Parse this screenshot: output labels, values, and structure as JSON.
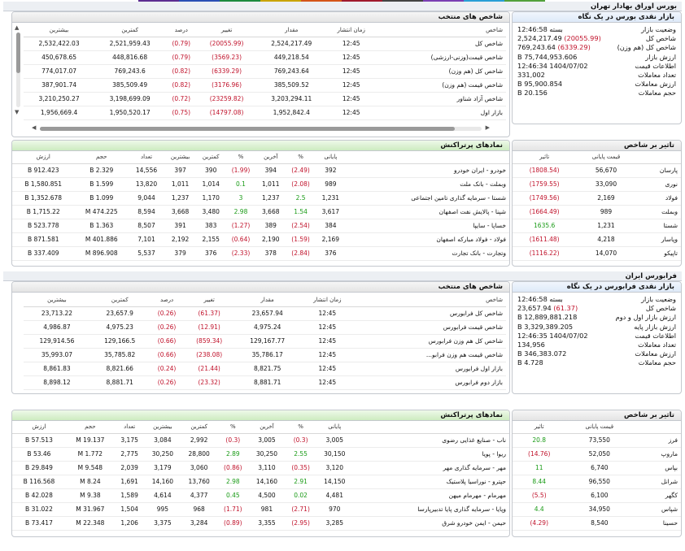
{
  "colors": {
    "neg": "#c0112a",
    "pos": "#1a9b17",
    "header_blue": "#dde9f8",
    "header_green": "#cdebc0"
  },
  "color_strip": [
    "#5c2d91",
    "#2a4fb5",
    "#1b8a3e",
    "#c9a400",
    "#d4561a",
    "#a01a2e",
    "#444444",
    "#7a3fb3",
    "#2a9fd6",
    "#53a13b"
  ],
  "tse": {
    "section_title": "بورس اوراق بهادار تهران",
    "glance": {
      "title": "بازار نقدی بورس در یک نگاه",
      "rows": [
        {
          "label": "وضعیت بازار",
          "value": "بسته 12:46:58",
          "cls": ""
        },
        {
          "label": "شاخص کل",
          "value": "2,524,217.49",
          "change": "(20055.99)",
          "cls": "neg"
        },
        {
          "label": "شاخص کل (هم وزن)",
          "value": "769,243.64",
          "change": "(6339.29)",
          "cls": "neg"
        },
        {
          "label": "ارزش بازار",
          "value": "75,744,953.606 B",
          "cls": ""
        },
        {
          "label": "اطلاعات قیمت",
          "value": "1404/07/02 12:46:34",
          "cls": ""
        },
        {
          "label": "تعداد معاملات",
          "value": "331,002",
          "cls": ""
        },
        {
          "label": "ارزش معاملات",
          "value": "95,900.854 B",
          "cls": ""
        },
        {
          "label": "حجم معاملات",
          "value": "20.156 B",
          "cls": ""
        }
      ]
    },
    "indices": {
      "title": "شاخص های منتخب",
      "headers": [
        "شاخص",
        "زمان انتشار",
        "مقدار",
        "تغییر",
        "درصد",
        "کمترین",
        "بیشترین"
      ],
      "rows": [
        [
          "شاخص کل",
          "12:45",
          "2,524,217.49",
          "(20055.99)",
          "(0.79)",
          "2,521,959.43",
          "2,532,422.03"
        ],
        [
          "شاخص قیمت(وزنی-ارزشی)",
          "12:45",
          "449,218.54",
          "(3569.23)",
          "(0.79)",
          "448,816.68",
          "450,678.65"
        ],
        [
          "شاخص کل (هم وزن)",
          "12:45",
          "769,243.64",
          "(6339.29)",
          "(0.82)",
          "769,243.6",
          "774,017.07"
        ],
        [
          "شاخص قیمت (هم وزن)",
          "12:45",
          "385,509.52",
          "(3176.96)",
          "(0.82)",
          "385,509.49",
          "387,901.74"
        ],
        [
          "شاخص آزاد شناور",
          "12:45",
          "3,203,294.11",
          "(23259.82)",
          "(0.72)",
          "3,198,699.09",
          "3,210,250.27"
        ],
        [
          "بازار اول",
          "12:45",
          "1,952,842.4",
          "(14797.08)",
          "(0.75)",
          "1,950,520.17",
          "1,956,669.4"
        ]
      ]
    },
    "impact": {
      "title": "تاثیر بر شاخص",
      "headers": [
        "",
        "قیمت پایانی",
        "تاثیر"
      ],
      "rows": [
        [
          "پارسان",
          "56,670",
          "(1808.54)",
          "neg"
        ],
        [
          "نوری",
          "33,090",
          "(1759.55)",
          "neg"
        ],
        [
          "فولاد",
          "2,169",
          "(1749.56)",
          "neg"
        ],
        [
          "وبملت",
          "989",
          "(1664.49)",
          "neg"
        ],
        [
          "شستا",
          "1,231",
          "1635.6",
          "pos"
        ],
        [
          "وپاسار",
          "4,218",
          "(1611.48)",
          "neg"
        ],
        [
          "تاپیکو",
          "14,070",
          "(1116.22)",
          "neg"
        ]
      ]
    },
    "active": {
      "title": "نمادهای پرتراکنش",
      "headers": [
        "",
        "پایانی",
        "%",
        "آخرین",
        "%",
        "کمترین",
        "بیشترین",
        "تعداد",
        "حجم",
        "ارزش"
      ],
      "rows": [
        [
          "خودرو - ایران خودرو",
          "392",
          "(2.49)",
          "394",
          "(1.99)",
          "390",
          "397",
          "14,556",
          "2.329 B",
          "912.423 B"
        ],
        [
          "وبملت - بانک ملت",
          "989",
          "(2.08)",
          "1,011",
          "0.1",
          "1,014",
          "1,011",
          "13,820",
          "1.599 B",
          "1,580.851 B"
        ],
        [
          "شستا - سرمایه گذاری تامین اجتماعی",
          "1,231",
          "2.5",
          "1,237",
          "3",
          "1,170",
          "1,237",
          "9,044",
          "1.099 B",
          "1,352.678 B"
        ],
        [
          "شپنا - پالایش نفت اصفهان",
          "3,617",
          "1.54",
          "3,668",
          "2.98",
          "3,480",
          "3,668",
          "8,594",
          "474.225 M",
          "1,715.22 B"
        ],
        [
          "خساپا - سایپا",
          "384",
          "(2.54)",
          "389",
          "(1.27)",
          "383",
          "391",
          "8,507",
          "1.363 B",
          "523.778 B"
        ],
        [
          "فولاد - فولاد مبارکه اصفهان",
          "2,169",
          "(1.59)",
          "2,190",
          "(0.64)",
          "2,155",
          "2,192",
          "7,101",
          "401.886 M",
          "871.581 B"
        ],
        [
          "وتجارت - بانک تجارت",
          "376",
          "(2.84)",
          "378",
          "(2.33)",
          "376",
          "379",
          "5,537",
          "896.908 M",
          "337.409 B"
        ]
      ]
    }
  },
  "ifb": {
    "section_title": "فرابورس ایران",
    "glance": {
      "title": "بازار نقدی فرابورس در یک نگاه",
      "rows": [
        {
          "label": "وضعیت بازار",
          "value": "بسته 12:46:58",
          "cls": ""
        },
        {
          "label": "شاخص کل",
          "value": "23,657.94",
          "change": "(61.37)",
          "cls": "neg"
        },
        {
          "label": "ارزش بازار اول و دوم",
          "value": "12,889,881.218 B",
          "cls": ""
        },
        {
          "label": "ارزش بازار پایه",
          "value": "3,329,389.205 B",
          "cls": ""
        },
        {
          "label": "اطلاعات قیمت",
          "value": "1404/07/02 12:46:35",
          "cls": ""
        },
        {
          "label": "تعداد معاملات",
          "value": "134,956",
          "cls": ""
        },
        {
          "label": "ارزش معاملات",
          "value": "346,383.072 B",
          "cls": ""
        },
        {
          "label": "حجم معاملات",
          "value": "4.728 B",
          "cls": ""
        }
      ]
    },
    "indices": {
      "title": "شاخص های منتخب",
      "headers": [
        "شاخص",
        "زمان انتشار",
        "مقدار",
        "تغییر",
        "درصد",
        "کمترین",
        "بیشترین"
      ],
      "rows": [
        [
          "شاخص کل فرابورس",
          "12:45",
          "23,657.94",
          "(61.37)",
          "(0.26)",
          "23,657.9",
          "23,713.22"
        ],
        [
          "شاخص قیمت فرابورس",
          "12:45",
          "4,975.24",
          "(12.91)",
          "(0.26)",
          "4,975.23",
          "4,986.87"
        ],
        [
          "شاخص کل هم وزن فرابورس",
          "12:45",
          "129,167.77",
          "(859.34)",
          "(0.66)",
          "129,166.5",
          "129,914.56"
        ],
        [
          "شاخص قیمت هم وزن فرابو...",
          "12:45",
          "35,786.17",
          "(238.08)",
          "(0.66)",
          "35,785.82",
          "35,993.07"
        ],
        [
          "بازار اول فرابورس",
          "12:45",
          "8,821.75",
          "(21.44)",
          "(0.24)",
          "8,821.66",
          "8,861.83"
        ],
        [
          "بازار دوم فرابورس",
          "12:45",
          "8,881.71",
          "(23.32)",
          "(0.26)",
          "8,881.71",
          "8,898.12"
        ]
      ]
    },
    "impact": {
      "title": "تاثیر بر شاخص",
      "headers": [
        "",
        "قیمت پایانی",
        "تاثیر"
      ],
      "rows": [
        [
          "فرز",
          "73,550",
          "20.8",
          "pos"
        ],
        [
          "ماروپ",
          "52,050",
          "(14.76)",
          "neg"
        ],
        [
          "بپاس",
          "6,740",
          "11",
          "pos"
        ],
        [
          "شرانل",
          "96,550",
          "8.44",
          "pos"
        ],
        [
          "کگهر",
          "6,100",
          "(5.5)",
          "neg"
        ],
        [
          "شپاس",
          "34,950",
          "4.4",
          "pos"
        ],
        [
          "حسینا",
          "8,540",
          "(4.29)",
          "neg"
        ]
      ]
    },
    "active": {
      "title": "نمادهای پرتراکنش",
      "headers": [
        "",
        "پایانی",
        "%",
        "آخرین",
        "%",
        "کمترین",
        "بیشترین",
        "تعداد",
        "حجم",
        "ارزش"
      ],
      "rows": [
        [
          "ناب - صنایع غذایی رضوی",
          "3,005",
          "(0.3)",
          "3,005",
          "(0.3)",
          "2,992",
          "3,084",
          "3,175",
          "19.137 M",
          "57.513 B"
        ],
        [
          "ریوا - پویا",
          "30,150",
          "2.55",
          "30,250",
          "2.89",
          "28,800",
          "30,250",
          "2,775",
          "1.772 M",
          "53.46 B"
        ],
        [
          "مهر - سرمایه گذاری مهر",
          "3,120",
          "(0.35)",
          "3,110",
          "(0.86)",
          "3,060",
          "3,179",
          "2,039",
          "9.548 M",
          "29.849 B"
        ],
        [
          "حپترو - نوراسیا پلاستیک",
          "14,150",
          "2.91",
          "14,160",
          "2.98",
          "13,760",
          "14,160",
          "1,691",
          "8.24 M",
          "116.568 B"
        ],
        [
          "مهرمام - مهرمام میهن",
          "4,481",
          "0.02",
          "4,500",
          "0.45",
          "4,377",
          "4,614",
          "1,589",
          "9.38 M",
          "42.028 B"
        ],
        [
          "وپایا - سرمایه گذاری پایا تدبیرپارسا",
          "970",
          "(2.71)",
          "981",
          "(1.71)",
          "968",
          "995",
          "1,504",
          "31.967 M",
          "31.022 B"
        ],
        [
          "حیمن - ایمن خودرو شرق",
          "3,285",
          "(2.95)",
          "3,355",
          "(0.89)",
          "3,284",
          "3,375",
          "1,206",
          "22.348 M",
          "73.417 B"
        ]
      ]
    }
  }
}
